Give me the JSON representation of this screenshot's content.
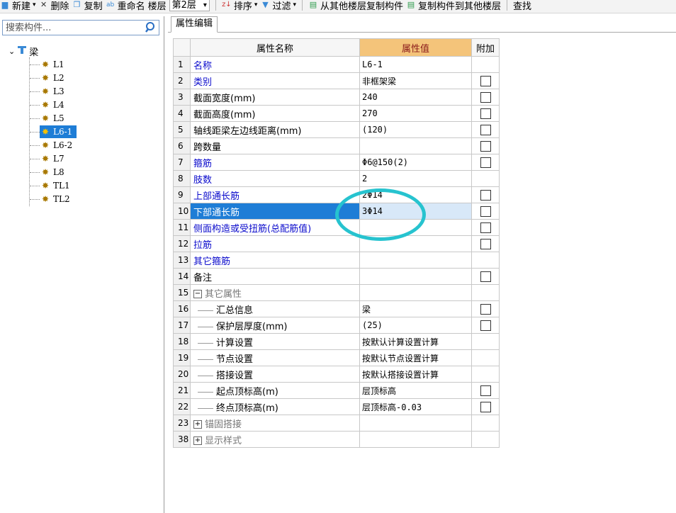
{
  "toolbar": {
    "items": [
      {
        "label": "新建",
        "icon": "new-icon",
        "dropdown": true
      },
      {
        "label": "删除",
        "icon": "delete-icon"
      },
      {
        "label": "复制",
        "icon": "copy-icon"
      },
      {
        "label": "重命名",
        "icon": "rename-icon"
      },
      {
        "label": "楼层",
        "icon": ""
      }
    ],
    "floor_value": "第2层",
    "sort_label": "排序",
    "filter_label": "过滤",
    "copy_from_label": "从其他楼层复制构件",
    "copy_to_label": "复制构件到其他楼层",
    "find_label": "查找"
  },
  "search": {
    "placeholder": "搜索构件..."
  },
  "tree": {
    "root_label": "梁",
    "items": [
      {
        "label": "L1",
        "selected": false
      },
      {
        "label": "L2",
        "selected": false
      },
      {
        "label": "L3",
        "selected": false
      },
      {
        "label": "L4",
        "selected": false
      },
      {
        "label": "L5",
        "selected": false
      },
      {
        "label": "L6-1",
        "selected": true
      },
      {
        "label": "L6-2",
        "selected": false
      },
      {
        "label": "L7",
        "selected": false
      },
      {
        "label": "L8",
        "selected": false
      },
      {
        "label": "TL1",
        "selected": false
      },
      {
        "label": "TL2",
        "selected": false
      }
    ]
  },
  "tab": {
    "label": "属性编辑"
  },
  "grid": {
    "headers": {
      "name": "属性名称",
      "value": "属性值",
      "extra": "附加"
    },
    "rows": [
      {
        "num": "1",
        "name": "名称",
        "value": "L6-1",
        "blue": true,
        "checkbox": false,
        "type": "normal"
      },
      {
        "num": "2",
        "name": "类别",
        "value": "非框架梁",
        "blue": true,
        "checkbox": true,
        "type": "normal"
      },
      {
        "num": "3",
        "name": "截面宽度(mm)",
        "value": "240",
        "blue": false,
        "checkbox": true,
        "type": "normal"
      },
      {
        "num": "4",
        "name": "截面高度(mm)",
        "value": "270",
        "blue": false,
        "checkbox": true,
        "type": "normal"
      },
      {
        "num": "5",
        "name": "轴线距梁左边线距离(mm)",
        "value": "(120)",
        "blue": false,
        "checkbox": true,
        "type": "normal"
      },
      {
        "num": "6",
        "name": "跨数量",
        "value": "",
        "blue": false,
        "checkbox": true,
        "type": "normal"
      },
      {
        "num": "7",
        "name": "箍筋",
        "value": "Φ6@150(2)",
        "blue": true,
        "checkbox": true,
        "type": "normal"
      },
      {
        "num": "8",
        "name": "肢数",
        "value": "2",
        "blue": true,
        "checkbox": false,
        "type": "normal"
      },
      {
        "num": "9",
        "name": "上部通长筋",
        "value": "2Φ14",
        "blue": true,
        "checkbox": true,
        "type": "normal"
      },
      {
        "num": "10",
        "name": "下部通长筋",
        "value": "3Φ14",
        "blue": true,
        "checkbox": true,
        "type": "selected"
      },
      {
        "num": "11",
        "name": "侧面构造或受扭筋(总配筋值)",
        "value": "",
        "blue": true,
        "checkbox": true,
        "type": "normal"
      },
      {
        "num": "12",
        "name": "拉筋",
        "value": "",
        "blue": true,
        "checkbox": true,
        "type": "normal"
      },
      {
        "num": "13",
        "name": "其它箍筋",
        "value": "",
        "blue": true,
        "checkbox": false,
        "type": "normal"
      },
      {
        "num": "14",
        "name": "备注",
        "value": "",
        "blue": false,
        "checkbox": true,
        "type": "normal"
      },
      {
        "num": "15",
        "name": "其它属性",
        "value": "",
        "blue": false,
        "checkbox": false,
        "type": "group-open"
      },
      {
        "num": "16",
        "name": "汇总信息",
        "value": "梁",
        "blue": false,
        "checkbox": true,
        "type": "child"
      },
      {
        "num": "17",
        "name": "保护层厚度(mm)",
        "value": "(25)",
        "blue": false,
        "checkbox": true,
        "type": "child"
      },
      {
        "num": "18",
        "name": "计算设置",
        "value": "按默认计算设置计算",
        "blue": false,
        "checkbox": false,
        "type": "child"
      },
      {
        "num": "19",
        "name": "节点设置",
        "value": "按默认节点设置计算",
        "blue": false,
        "checkbox": false,
        "type": "child"
      },
      {
        "num": "20",
        "name": "搭接设置",
        "value": "按默认搭接设置计算",
        "blue": false,
        "checkbox": false,
        "type": "child"
      },
      {
        "num": "21",
        "name": "起点顶标高(m)",
        "value": "层顶标高",
        "blue": false,
        "checkbox": true,
        "type": "child"
      },
      {
        "num": "22",
        "name": "终点顶标高(m)",
        "value": "层顶标高-0.03",
        "blue": false,
        "checkbox": true,
        "type": "child"
      },
      {
        "num": "23",
        "name": "锚固搭接",
        "value": "",
        "blue": false,
        "checkbox": false,
        "type": "group-closed"
      },
      {
        "num": "38",
        "name": "显示样式",
        "value": "",
        "blue": false,
        "checkbox": false,
        "type": "group-closed"
      }
    ]
  },
  "colors": {
    "selection_blue": "#1e7dd6",
    "value_header": "#f4c47a",
    "highlight_circle": "#27c3cf",
    "link_blue": "#0a0acc"
  }
}
